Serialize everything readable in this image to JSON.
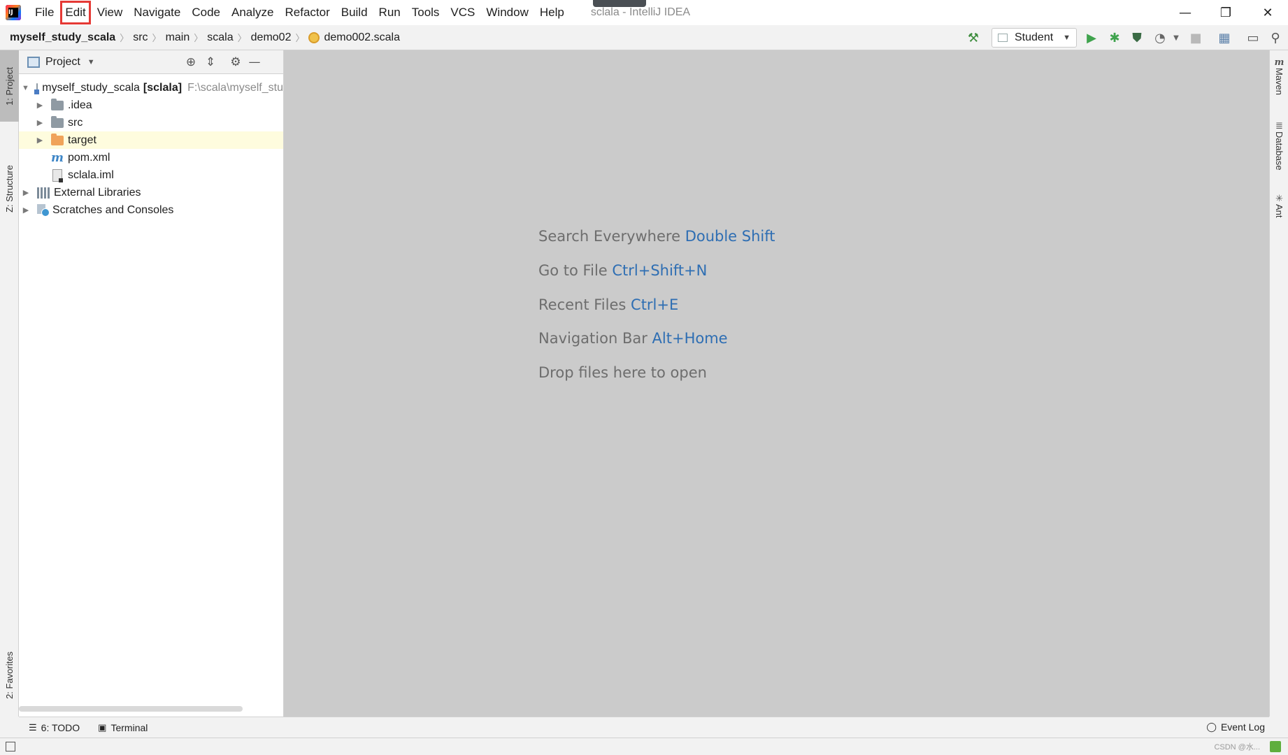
{
  "app": {
    "window_title": "sclala - IntelliJ IDEA",
    "brand_color": "#e53935"
  },
  "menu": {
    "items": [
      "File",
      "Edit",
      "View",
      "Navigate",
      "Code",
      "Analyze",
      "Refactor",
      "Build",
      "Run",
      "Tools",
      "VCS",
      "Window",
      "Help"
    ],
    "highlighted_item": "Edit"
  },
  "window_controls": {
    "minimize": "—",
    "restore": "❐",
    "close": "✕"
  },
  "breadcrumb": {
    "items": [
      "myself_study_scala",
      "src",
      "main",
      "scala",
      "demo02",
      "demo002.scala"
    ]
  },
  "toolbar": {
    "run_config": "Student",
    "icons": [
      "hammer-icon",
      "run-icon",
      "debug-icon",
      "coverage-icon",
      "profile-icon",
      "stop-icon",
      "project-structure-icon",
      "terminal-window-icon",
      "search-icon"
    ]
  },
  "left_stripe": {
    "project_tab": "1: Project",
    "structure_tab": "Z: Structure",
    "favorites_tab": "2: Favorites"
  },
  "right_stripe": {
    "maven_tab": "Maven",
    "database_tab": "Database",
    "ant_tab": "Ant"
  },
  "project_panel": {
    "title": "Project",
    "tree": {
      "root_name": "myself_study_scala",
      "root_module": "[sclala]",
      "root_path": "F:\\scala\\myself_stu",
      "idea": ".idea",
      "src": "src",
      "target": "target",
      "pom": "pom.xml",
      "iml": "sclala.iml",
      "ext_libs": "External Libraries",
      "scratches": "Scratches and Consoles"
    }
  },
  "editor_hints": [
    {
      "text": "Search Everywhere",
      "shortcut": "Double Shift"
    },
    {
      "text": "Go to File",
      "shortcut": "Ctrl+Shift+N"
    },
    {
      "text": "Recent Files",
      "shortcut": "Ctrl+E"
    },
    {
      "text": "Navigation Bar",
      "shortcut": "Alt+Home"
    },
    {
      "text": "Drop files here to open",
      "shortcut": ""
    }
  ],
  "bottom_tools": {
    "todo": "6: TODO",
    "terminal": "Terminal",
    "event_log": "Event Log"
  },
  "status_bar": {
    "watermark": "CSDN @水..."
  }
}
